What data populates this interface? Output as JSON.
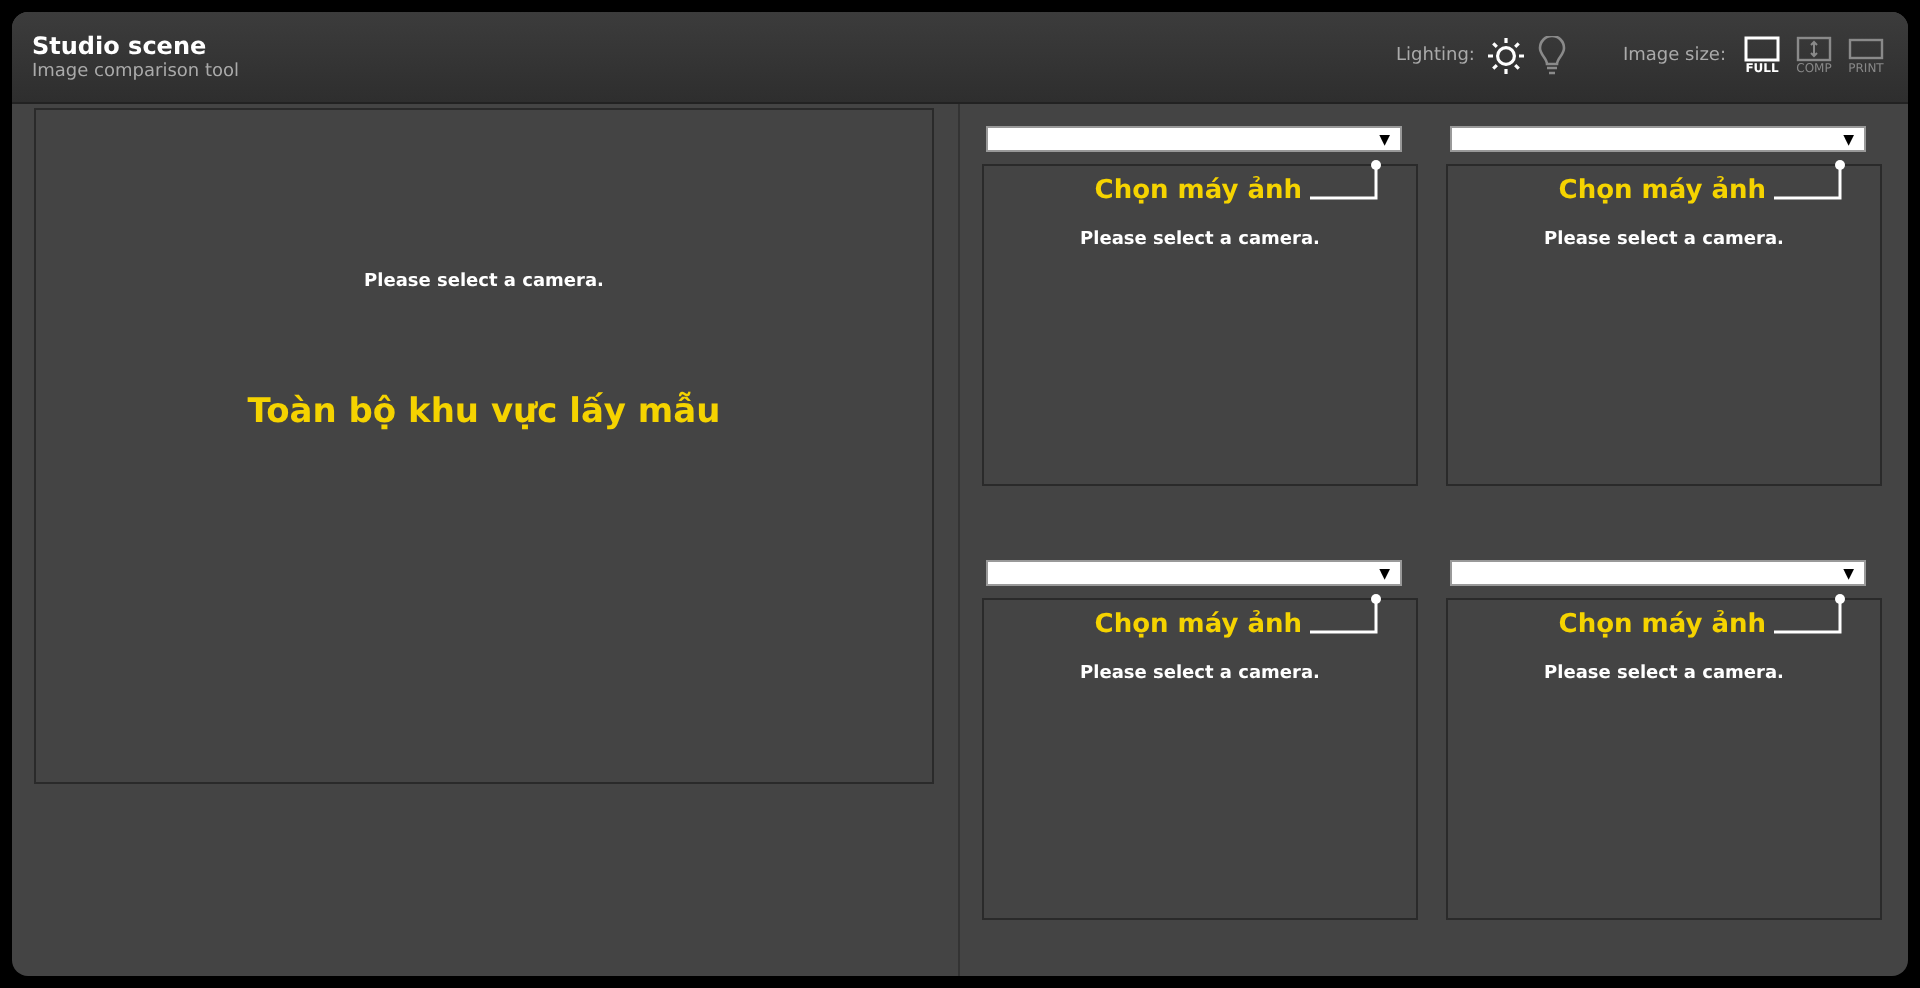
{
  "header": {
    "title": "Studio scene",
    "subtitle": "Image comparison tool",
    "lighting": {
      "label": "Lighting:",
      "options": [
        {
          "kind": "sun",
          "selected": true
        },
        {
          "kind": "bulb",
          "selected": false
        }
      ]
    },
    "image_size": {
      "label": "Image size:",
      "options": [
        {
          "kind": "full",
          "label": "FULL",
          "selected": true
        },
        {
          "kind": "comp",
          "label": "COMP",
          "selected": false
        },
        {
          "kind": "print",
          "label": "PRINT",
          "selected": false
        }
      ]
    }
  },
  "main_view": {
    "message": "Please select a camera.",
    "annotation": "Toàn bộ khu vực lấy mẫu"
  },
  "camera_slots": [
    {
      "arrow": "▼",
      "annotation": "Chọn máy ảnh",
      "message": "Please select a camera."
    },
    {
      "arrow": "▼",
      "annotation": "Chọn máy ảnh",
      "message": "Please select a camera."
    },
    {
      "arrow": "▼",
      "annotation": "Chọn máy ảnh",
      "message": "Please select a camera."
    },
    {
      "arrow": "▼",
      "annotation": "Chọn máy ảnh",
      "message": "Please select a camera."
    }
  ]
}
